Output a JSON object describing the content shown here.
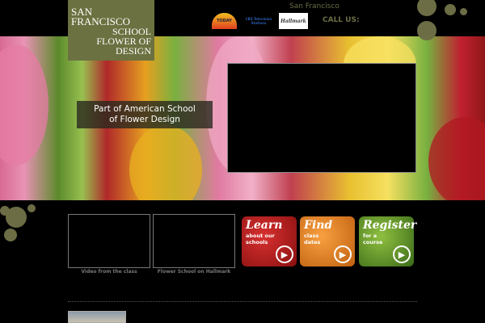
{
  "logo": {
    "line1": "San Francisco",
    "line2": "School",
    "line3": "Flower of",
    "line4": "Design"
  },
  "header": {
    "location": "San Francisco",
    "call_label": "CALL US:",
    "media": [
      "TODAY",
      "CBS Television Stations",
      "Hallmark"
    ]
  },
  "hero": {
    "tagline_line1": "Part of American School",
    "tagline_line2": "of Flower Design"
  },
  "videos": [
    {
      "caption": "Video from the class"
    },
    {
      "caption": "Flower School on Hallmark"
    }
  ],
  "promos": [
    {
      "title": "Learn",
      "subtitle": "about our schools",
      "color": "#b81c1c"
    },
    {
      "title": "Find",
      "subtitle": "class dates",
      "color": "#e8801e"
    },
    {
      "title": "Register",
      "subtitle": "for a course",
      "color": "#6a9a2a"
    }
  ],
  "colors": {
    "olive": "#6c6d45",
    "logo_bg": "#6b7140"
  }
}
